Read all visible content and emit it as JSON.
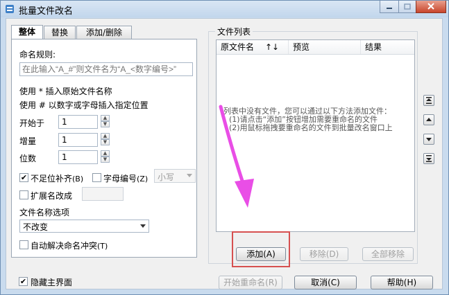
{
  "window": {
    "title": "批量文件改名"
  },
  "tabs": [
    {
      "label": "整体",
      "active": true
    },
    {
      "label": "替换",
      "active": false
    },
    {
      "label": "添加/删除",
      "active": false
    }
  ],
  "naming": {
    "rule_label": "命名规则:",
    "rule_placeholder": "在此输入“A_#”则文件名为“A_<数字编号>”",
    "hint_star": "使用 * 插入原始文件名称",
    "hint_hash": "使用 # 以数字或字母插入指定位置"
  },
  "fields": {
    "start_label": "开始于",
    "start_value": "1",
    "increment_label": "增量",
    "increment_value": "1",
    "digits_label": "位数",
    "digits_value": "1"
  },
  "options": {
    "pad_label": "不足位补齐",
    "pad_key": "(B)",
    "pad_checked": true,
    "alpha_label": "字母编号",
    "alpha_key": "(Z)",
    "alpha_checked": false,
    "case_value": "小写",
    "ext_label": "扩展名改成",
    "ext_checked": false,
    "filename_options_label": "文件名称选项",
    "filename_options_value": "不改变",
    "autoresolve_label": "自动解决命名冲突",
    "autoresolve_key": "(T)",
    "autoresolve_checked": false
  },
  "file_list": {
    "title": "文件列表",
    "columns": [
      "原文件名",
      "↑↓",
      "预览",
      "结果"
    ],
    "empty_line1": "列表中没有文件，您可以通过以下方法添加文件：",
    "empty_line2": "(1)请点击“添加”按钮增加需要重命名的文件",
    "empty_line3": "(2)用鼠标拖拽要重命名的文件到批量改名窗口上",
    "side_buttons": [
      "top-icon",
      "up-icon",
      "down-icon",
      "bottom-icon"
    ]
  },
  "buttons": {
    "add": "添加(A)",
    "remove": "移除(D)",
    "remove_all": "全部移除",
    "start_rename": "开始重命名(R)",
    "cancel": "取消(C)",
    "help": "帮助(H)"
  },
  "footer": {
    "hide_main_label": "隐藏主界面",
    "hide_main_checked": true
  },
  "colors": {
    "annotation_arrow": "#e94ee6",
    "annotation_box": "#d65050"
  }
}
